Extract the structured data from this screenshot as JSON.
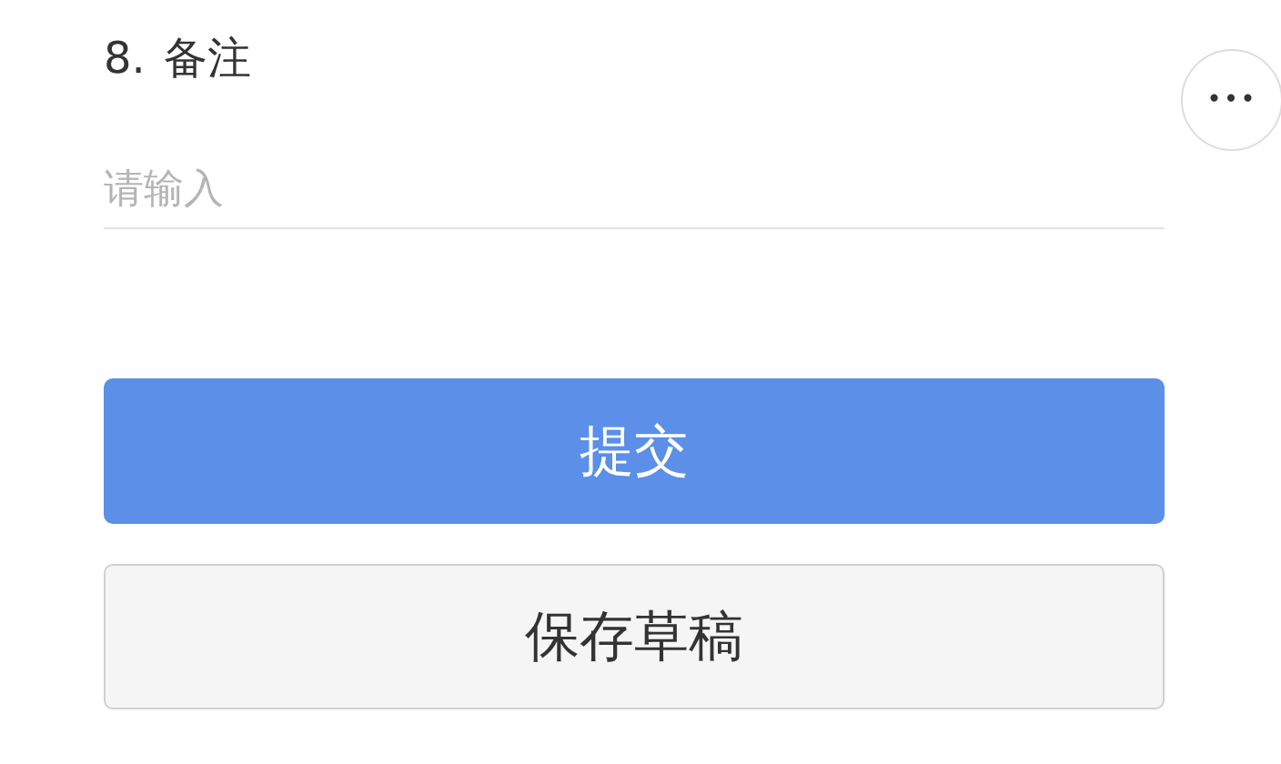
{
  "question": {
    "number": "8.",
    "title": "备注"
  },
  "field": {
    "placeholder": "请输入"
  },
  "more_button": {
    "label": "•••"
  },
  "buttons": [
    {
      "label": "提交",
      "kind": "primary"
    },
    {
      "label": "保存草稿",
      "kind": "secondary"
    }
  ]
}
